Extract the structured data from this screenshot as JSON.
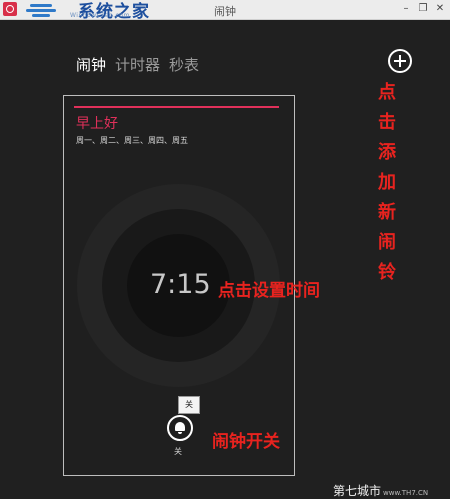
{
  "window": {
    "title": "闹钟",
    "minimize_glyph": "–",
    "restore_glyph": "❐",
    "close_glyph": "✕"
  },
  "watermark_logo": {
    "text": "系统之家",
    "subtext": "Windows7en.com"
  },
  "tabs": [
    {
      "label": "闹钟",
      "active": true
    },
    {
      "label": "计时器",
      "active": false
    },
    {
      "label": "秒表",
      "active": false
    }
  ],
  "add_button": {
    "icon": "plus-circle-icon"
  },
  "annotations": {
    "add_alarm": [
      "点击",
      "添加",
      "新闹",
      "铃"
    ],
    "set_time": "点击设置时间",
    "toggle": "闹钟开关"
  },
  "alarm": {
    "name": "早上好",
    "days": "周一、周二、周三、周四、周五",
    "time": "7:15",
    "toggle_tooltip": "关",
    "toggle_label": "关",
    "toggle_icon": "bell-icon",
    "accent_color": "#e0305a"
  },
  "watermark": {
    "text": "第七城市",
    "subtext": "www.TH7.CN"
  }
}
